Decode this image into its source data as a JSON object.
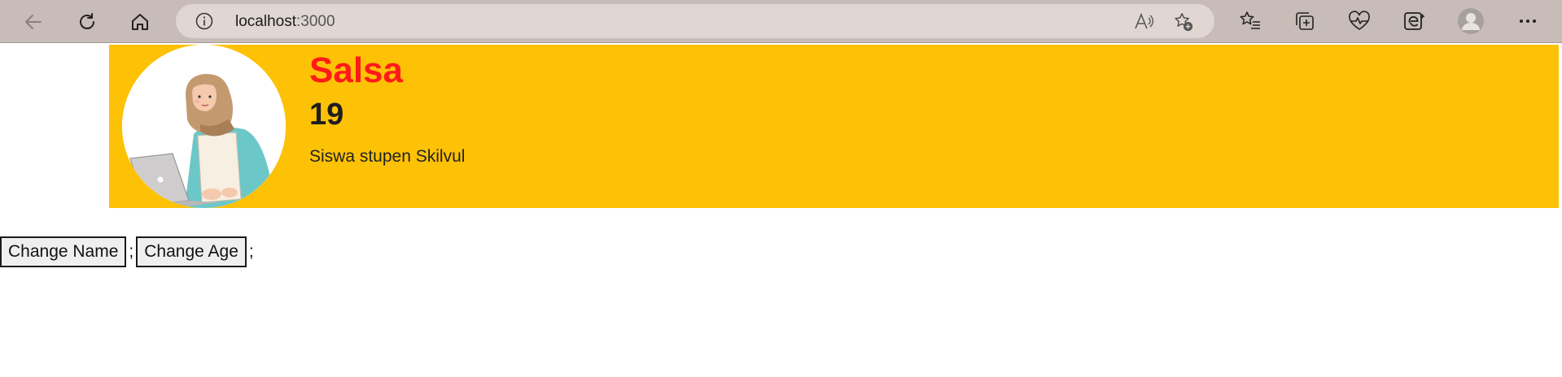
{
  "browser": {
    "url_host": "localhost",
    "url_port": ":3000",
    "icons": {
      "back": "back-arrow-icon",
      "refresh": "refresh-icon",
      "home": "home-icon",
      "site_info": "info-icon",
      "read_aloud": "read-aloud-icon",
      "add_favorite": "add-favorite-icon",
      "favorites": "favorites-icon",
      "collections": "collections-icon",
      "performance": "heartbeat-icon",
      "edge_logo": "edge-icon",
      "profile": "profile-icon",
      "more": "more-icon"
    },
    "colors": {
      "chrome": "#c8bcb8",
      "omnibox": "#e0d7d3"
    }
  },
  "profile": {
    "name": "Salsa",
    "age": "19",
    "description": "Siswa stupen Skilvul",
    "colors": {
      "card": "#fdc106",
      "name": "#ff1a1a"
    }
  },
  "actions": {
    "change_name_label": "Change Name",
    "change_age_label": "Change Age",
    "separator_1": ";",
    "separator_2": ";"
  }
}
